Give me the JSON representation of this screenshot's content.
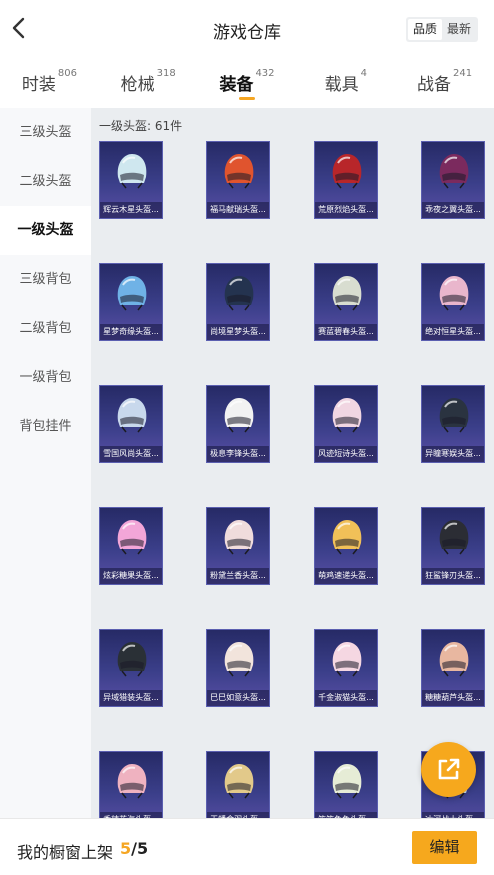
{
  "header": {
    "title": "游戏仓库",
    "sort_options": [
      "品质",
      "最新"
    ],
    "active_sort": 0
  },
  "tabs": [
    {
      "label": "时装",
      "count": "806"
    },
    {
      "label": "枪械",
      "count": "318"
    },
    {
      "label": "装备",
      "count": "432",
      "active": true
    },
    {
      "label": "载具",
      "count": "4"
    },
    {
      "label": "战备",
      "count": "241"
    }
  ],
  "sidebar": {
    "items": [
      "三级头盔",
      "二级头盔",
      "一级头盔",
      "三级背包",
      "二级背包",
      "一级背包",
      "背包挂件"
    ],
    "active_index": 2
  },
  "content": {
    "section_title": "一级头盔: 61件",
    "items": [
      {
        "name": "辉云木星头盔...",
        "color": "#cfe7ef"
      },
      {
        "name": "福马献瑞头盔...",
        "color": "#e0542e"
      },
      {
        "name": "荒原烈焰头盔...",
        "color": "#b8262a"
      },
      {
        "name": "乖夜之翼头盔...",
        "color": "#7b2a5e"
      },
      {
        "name": "星梦奇缘头盔...",
        "color": "#6fb2e6"
      },
      {
        "name": "尚境星梦头盔...",
        "color": "#24334f"
      },
      {
        "name": "赛蓝碧春头盔...",
        "color": "#d8ddd0"
      },
      {
        "name": "绝对恒星头盔...",
        "color": "#e9b6cc"
      },
      {
        "name": "雪国风尚头盔...",
        "color": "#c8d8ec"
      },
      {
        "name": "极息李锋头盔...",
        "color": "#f2f2f2"
      },
      {
        "name": "风迹短诗头盔...",
        "color": "#f1d6e2"
      },
      {
        "name": "异瞳寒娱头盔...",
        "color": "#2a3340"
      },
      {
        "name": "炫彩糖果头盔...",
        "color": "#f3a6d8"
      },
      {
        "name": "粉黛兰香头盔...",
        "color": "#f0dcdc"
      },
      {
        "name": "萌鸡速递头盔...",
        "color": "#f1c058"
      },
      {
        "name": "狂鲨锋刃头盔...",
        "color": "#2b2d34"
      },
      {
        "name": "异域猎装头盔...",
        "color": "#2a3036"
      },
      {
        "name": "巳巳如意头盔...",
        "color": "#f2e4dc"
      },
      {
        "name": "千金淑猫头盔...",
        "color": "#f5d7e2"
      },
      {
        "name": "糖糖葫芦头盔...",
        "color": "#e8b7a0"
      },
      {
        "name": "香辣花海头盔...",
        "color": "#efb2c0"
      },
      {
        "name": "玉幡金羽头盔...",
        "color": "#e2c98a"
      },
      {
        "name": "笨笨兔兔头盔...",
        "color": "#e6ecd6"
      },
      {
        "name": "冰河战士头盔...",
        "color": "#c7ddec"
      }
    ]
  },
  "fab": {
    "icon": "share-icon"
  },
  "bottom_bar": {
    "label": "我的橱窗上架",
    "current": "5",
    "total": "/5",
    "edit_label": "编辑"
  }
}
